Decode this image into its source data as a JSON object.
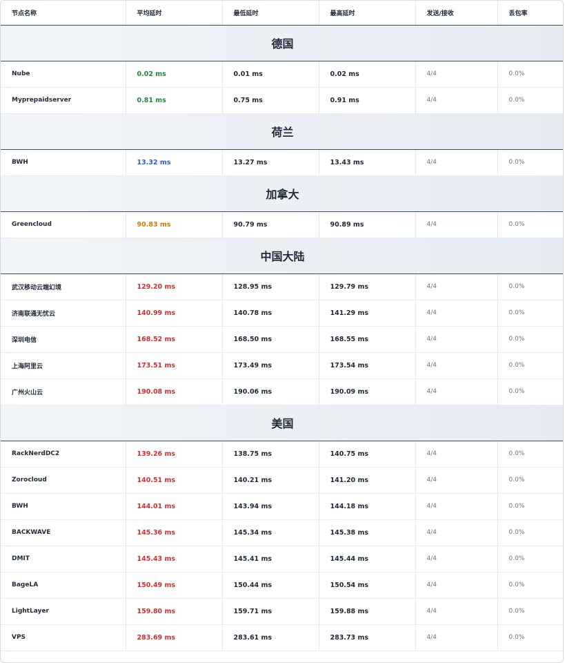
{
  "columns": [
    "节点名称",
    "平均延时",
    "最低延时",
    "最高延时",
    "发送/接收",
    "丢包率"
  ],
  "groups": [
    {
      "region": "德国",
      "rows": [
        {
          "name": "Nube",
          "avg": "0.02 ms",
          "min": "0.01 ms",
          "max": "0.02 ms",
          "sent": "4/4",
          "loss": "0.0%",
          "level": "green"
        },
        {
          "name": "Myprepaidserver",
          "avg": "0.81 ms",
          "min": "0.75 ms",
          "max": "0.91 ms",
          "sent": "4/4",
          "loss": "0.0%",
          "level": "green"
        }
      ]
    },
    {
      "region": "荷兰",
      "rows": [
        {
          "name": "BWH",
          "avg": "13.32 ms",
          "min": "13.27 ms",
          "max": "13.43 ms",
          "sent": "4/4",
          "loss": "0.0%",
          "level": "blue"
        }
      ]
    },
    {
      "region": "加拿大",
      "rows": [
        {
          "name": "Greencloud",
          "avg": "90.83 ms",
          "min": "90.79 ms",
          "max": "90.89 ms",
          "sent": "4/4",
          "loss": "0.0%",
          "level": "orange"
        }
      ]
    },
    {
      "region": "中国大陆",
      "rows": [
        {
          "name": "武汉移动云端幻境",
          "avg": "129.20 ms",
          "min": "128.95 ms",
          "max": "129.79 ms",
          "sent": "4/4",
          "loss": "0.0%",
          "level": "red"
        },
        {
          "name": "济南联通无忧云",
          "avg": "140.99 ms",
          "min": "140.78 ms",
          "max": "141.29 ms",
          "sent": "4/4",
          "loss": "0.0%",
          "level": "red"
        },
        {
          "name": "深圳电信",
          "avg": "168.52 ms",
          "min": "168.50 ms",
          "max": "168.55 ms",
          "sent": "4/4",
          "loss": "0.0%",
          "level": "red"
        },
        {
          "name": "上海阿里云",
          "avg": "173.51 ms",
          "min": "173.49 ms",
          "max": "173.54 ms",
          "sent": "4/4",
          "loss": "0.0%",
          "level": "red"
        },
        {
          "name": "广州火山云",
          "avg": "190.08 ms",
          "min": "190.06 ms",
          "max": "190.09 ms",
          "sent": "4/4",
          "loss": "0.0%",
          "level": "red"
        }
      ]
    },
    {
      "region": "美国",
      "rows": [
        {
          "name": "RackNerdDC2",
          "avg": "139.26 ms",
          "min": "138.75 ms",
          "max": "140.75 ms",
          "sent": "4/4",
          "loss": "0.0%",
          "level": "red"
        },
        {
          "name": "Zorocloud",
          "avg": "140.51 ms",
          "min": "140.21 ms",
          "max": "141.20 ms",
          "sent": "4/4",
          "loss": "0.0%",
          "level": "red"
        },
        {
          "name": "BWH",
          "avg": "144.01 ms",
          "min": "143.94 ms",
          "max": "144.18 ms",
          "sent": "4/4",
          "loss": "0.0%",
          "level": "red"
        },
        {
          "name": "BACKWAVE",
          "avg": "145.36 ms",
          "min": "145.34 ms",
          "max": "145.38 ms",
          "sent": "4/4",
          "loss": "0.0%",
          "level": "red"
        },
        {
          "name": "DMIT",
          "avg": "145.43 ms",
          "min": "145.41 ms",
          "max": "145.44 ms",
          "sent": "4/4",
          "loss": "0.0%",
          "level": "red"
        },
        {
          "name": "BageLA",
          "avg": "150.49 ms",
          "min": "150.44 ms",
          "max": "150.54 ms",
          "sent": "4/4",
          "loss": "0.0%",
          "level": "red"
        },
        {
          "name": "LightLayer",
          "avg": "159.80 ms",
          "min": "159.71 ms",
          "max": "159.88 ms",
          "sent": "4/4",
          "loss": "0.0%",
          "level": "red"
        },
        {
          "name": "VPS",
          "avg": "283.69 ms",
          "min": "283.61 ms",
          "max": "283.73 ms",
          "sent": "4/4",
          "loss": "0.0%",
          "level": "red"
        }
      ]
    }
  ],
  "colors": {
    "green": "#1a8a3a",
    "blue": "#2563c9",
    "orange": "#d07a0a",
    "red": "#d42e2e",
    "header_rule": "#3f4e6b"
  }
}
